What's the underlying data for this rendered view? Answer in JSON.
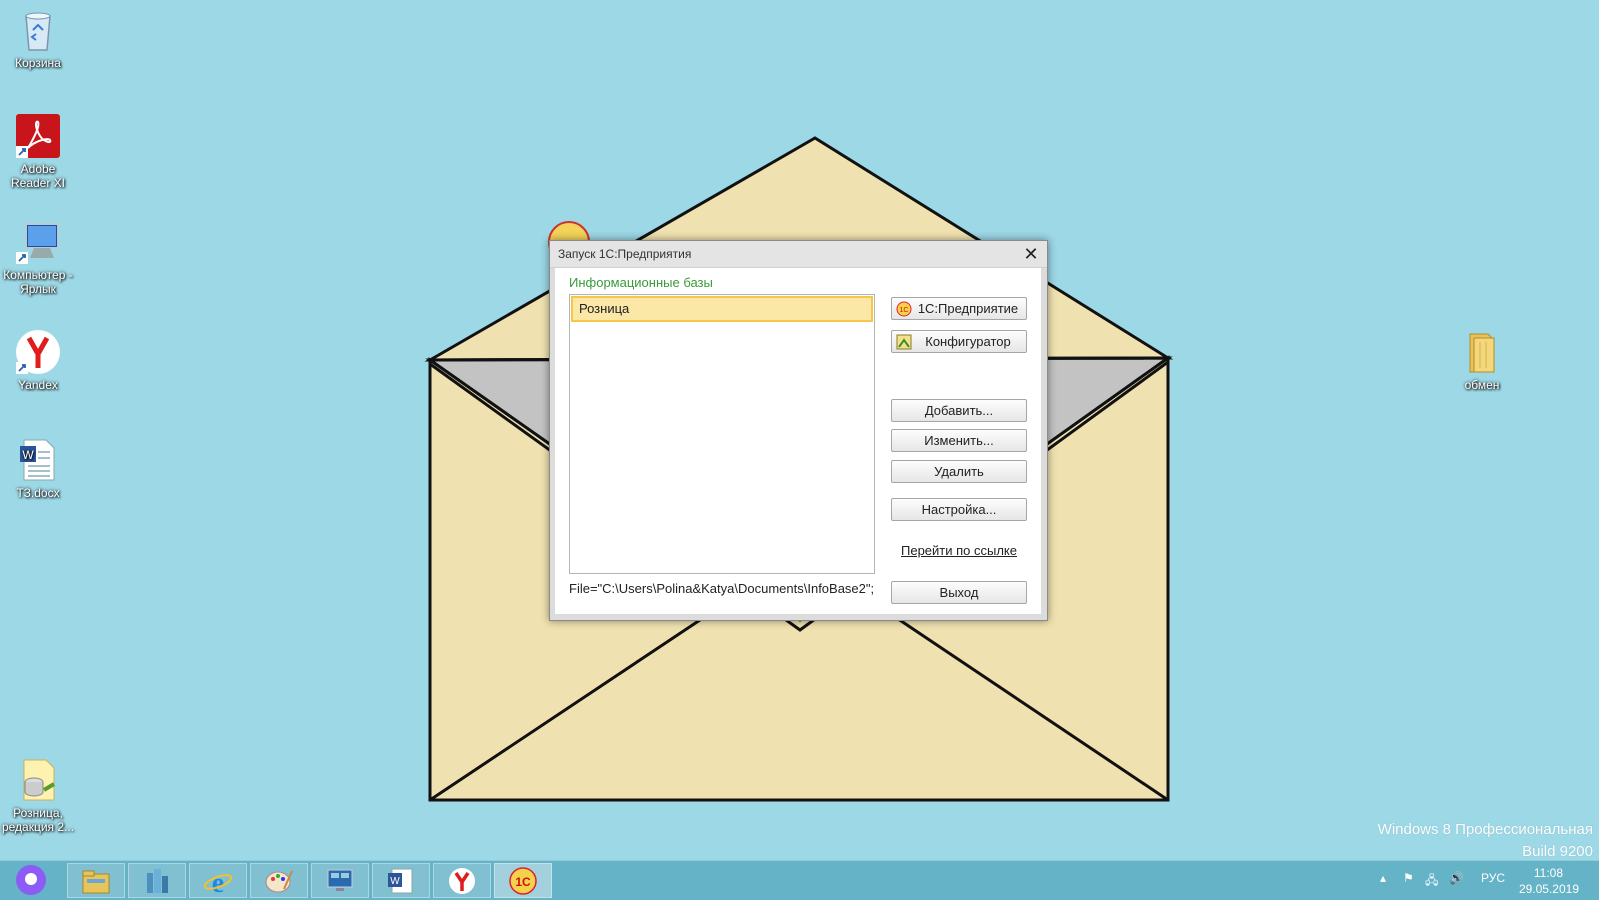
{
  "desktop": {
    "icons": [
      {
        "label": "Корзина",
        "icon": "recycle-bin-icon"
      },
      {
        "label": "Adobe Reader XI",
        "icon": "adobe-reader-icon"
      },
      {
        "label": "Компьютер - Ярлык",
        "icon": "computer-shortcut-icon"
      },
      {
        "label": "Yandex",
        "icon": "yandex-icon"
      },
      {
        "label": "ТЗ.docx",
        "icon": "word-document-icon"
      },
      {
        "label": "Розница, редакция 2...",
        "icon": "1c-database-icon"
      },
      {
        "label": "обмен",
        "icon": "folder-icon"
      }
    ],
    "watermark_line1": "Windows 8 Профессиональная",
    "watermark_line2": "Build 9200",
    "wallpaper_colors": {
      "sky": "#9dd8e6",
      "envelope": "#f0e2b0",
      "inner": "#c3c3c3"
    }
  },
  "dialog": {
    "title": "Запуск 1С:Предприятия",
    "close_glyph": "✕",
    "bases_heading": "Информационные базы",
    "bases": [
      "Розница"
    ],
    "selected_path": "File=\"C:\\Users\\Polina&Katya\\Documents\\InfoBase2\";",
    "buttons": {
      "enterprise": "1С:Предприятие",
      "configurator": "Конфигуратор",
      "add": "Добавить...",
      "edit": "Изменить...",
      "delete": "Удалить",
      "settings": "Настройка...",
      "exit": "Выход"
    },
    "link": "Перейти по ссылке",
    "heading_color": "#3a9a3a",
    "selection_color": "#fbe7a6"
  },
  "taskbar": {
    "apps": [
      "alice-icon",
      "file-explorer-icon",
      "city-icon",
      "internet-explorer-icon",
      "paint-icon",
      "remote-desktop-icon",
      "word-icon",
      "yandex-browser-icon",
      "1c-icon"
    ],
    "language": "РУС",
    "time": "11:08",
    "date": "29.05.2019"
  }
}
